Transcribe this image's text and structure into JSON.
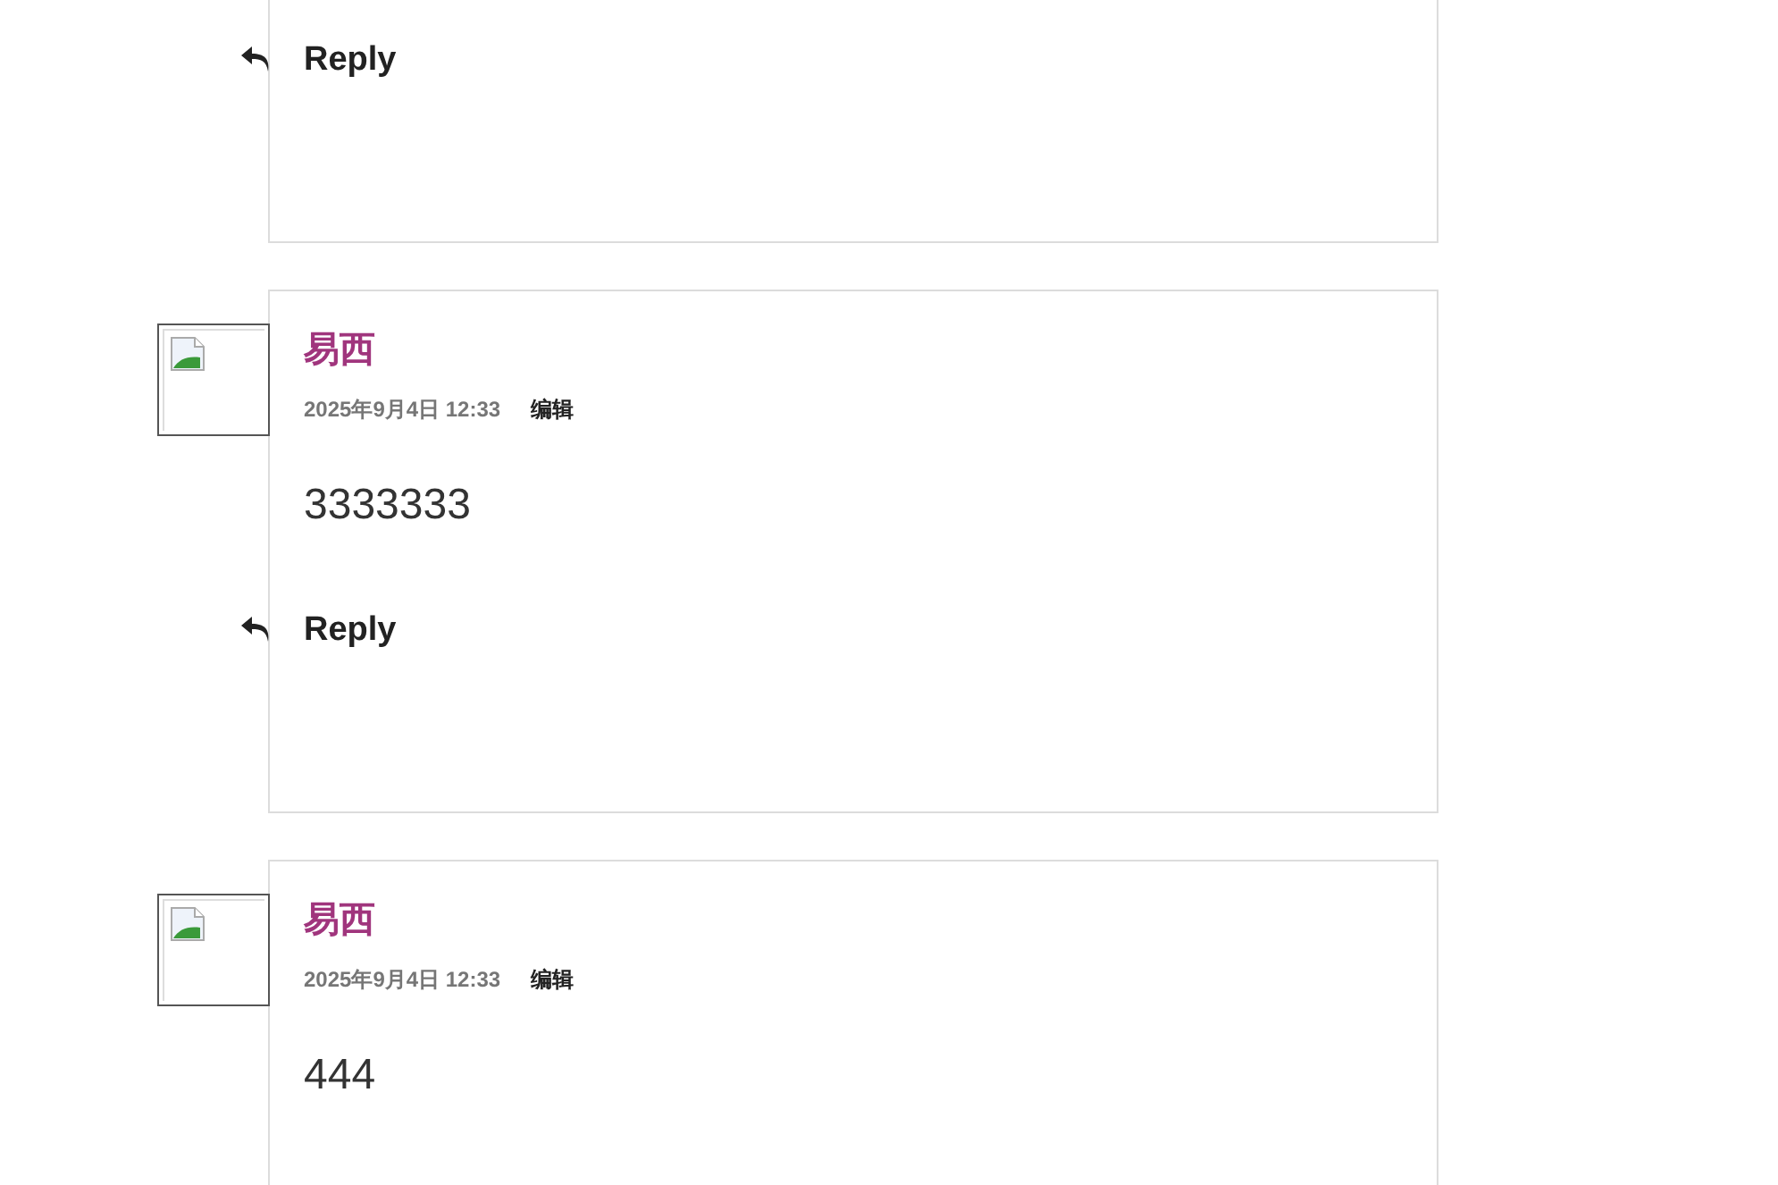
{
  "comments": [
    {
      "reply": "Reply"
    },
    {
      "author": "易西",
      "date": "2025年9月4日 12:33",
      "edit": "编辑",
      "text": "3333333",
      "reply": "Reply"
    },
    {
      "author": "易西",
      "date": "2025年9月4日 12:33",
      "edit": "编辑",
      "text": "444"
    }
  ]
}
